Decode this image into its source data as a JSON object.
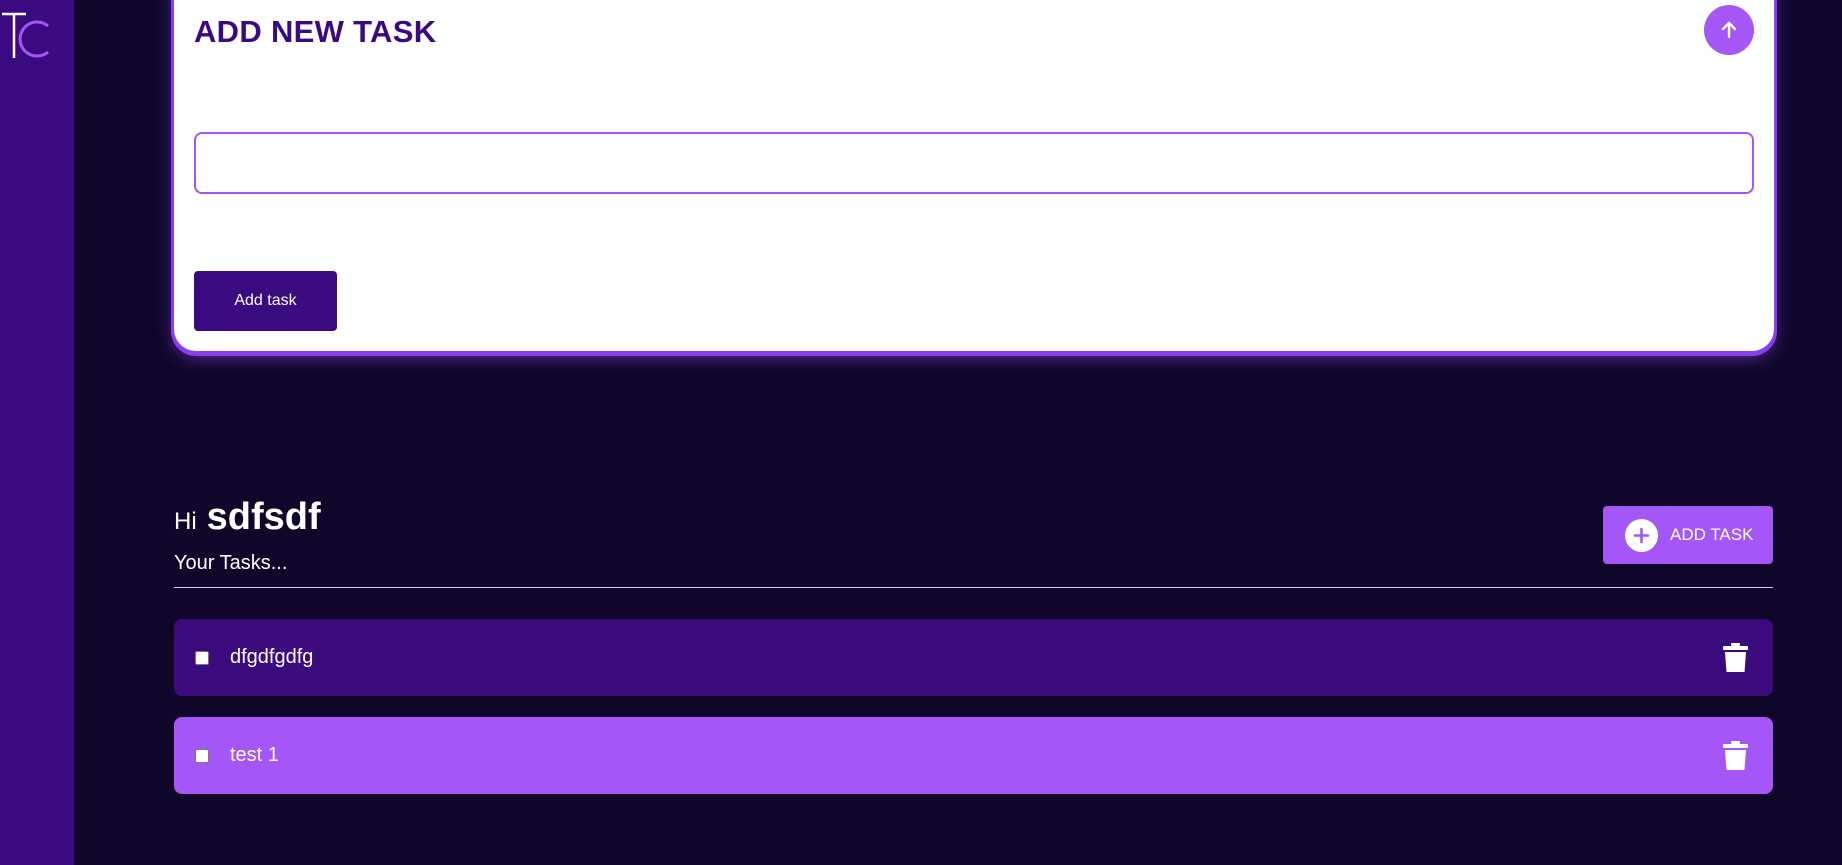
{
  "app": {
    "logo_text": "TC",
    "sidebar_color": "#3a0a80",
    "background_color": "#10062a",
    "accent_color": "#a456f6"
  },
  "add_panel": {
    "title": "ADD NEW TASK",
    "collapse_icon": "arrow-up-icon",
    "input_value": "",
    "input_placeholder": "",
    "submit_label": "Add task"
  },
  "header": {
    "greeting": "Hi",
    "username": "sdfsdf",
    "subtitle": "Your Tasks...",
    "add_button_label": "ADD TASK",
    "add_button_icon": "plus-circle-icon"
  },
  "tasks": [
    {
      "label": "dfgdfgdfg",
      "completed": false,
      "color": "#3b0a7c"
    },
    {
      "label": "test 1",
      "completed": false,
      "color": "#a456f6"
    }
  ]
}
